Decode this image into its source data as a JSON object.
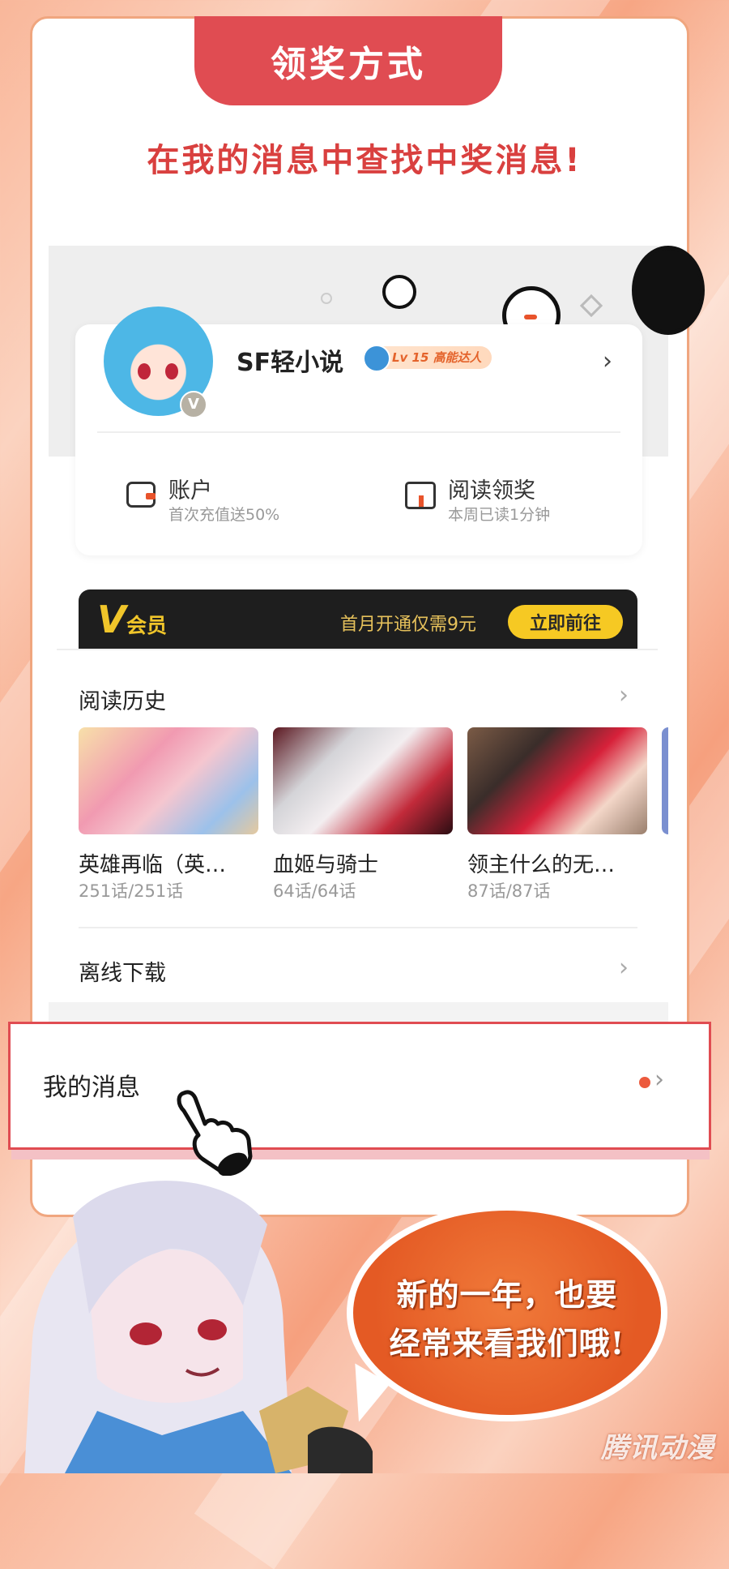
{
  "header": {
    "title": "领奖方式"
  },
  "headline": "在我的消息中查找中奖消息!",
  "profile": {
    "username": "SF轻小说",
    "level": "Lv 15 高能达人",
    "verified_badge": "V"
  },
  "stats": {
    "account": {
      "title": "账户",
      "subtitle": "首次充值送50%"
    },
    "reading_reward": {
      "title": "阅读领奖",
      "subtitle": "本周已读1分钟"
    }
  },
  "vip": {
    "v_glyph": "V",
    "label": "会员",
    "promo": "首月开通仅需9元",
    "button": "立即前往"
  },
  "reading_history": {
    "title": "阅读历史",
    "books": [
      {
        "name": "英雄再临（英…",
        "progress": "251话/251话"
      },
      {
        "name": "血姬与骑士",
        "progress": "64话/64话"
      },
      {
        "name": "领主什么的无…",
        "progress": "87话/87话"
      }
    ]
  },
  "offline_download": {
    "title": "离线下载"
  },
  "my_messages": {
    "title": "我的消息"
  },
  "speech_bubble": {
    "line1": "新的一年，也要",
    "line2": "经常来看我们哦!"
  },
  "watermark": "腾讯动漫",
  "colors": {
    "accent_red": "#e04c52",
    "headline_red": "#d9403f",
    "vip_gold": "#f0c52a",
    "bubble_orange": "#e45a24"
  }
}
